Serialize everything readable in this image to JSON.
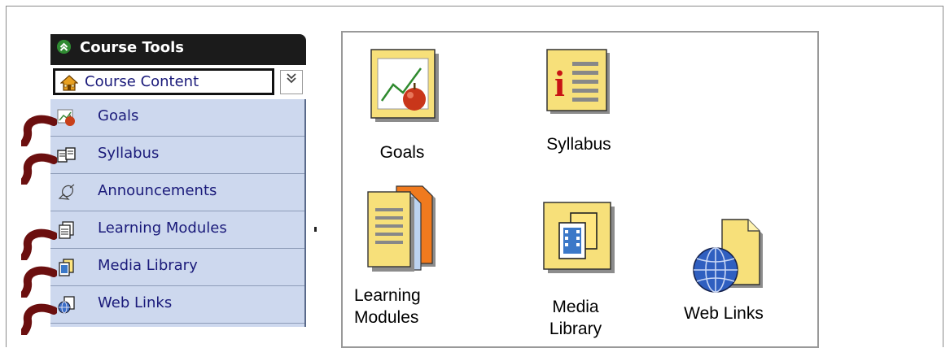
{
  "sidebar": {
    "header_title": "Course Tools",
    "collapse_glyph": "⇑",
    "course_content_label": "Course Content",
    "expand_glyph": "⌄",
    "items": [
      {
        "label": "Goals",
        "icon": "goals-icon"
      },
      {
        "label": "Syllabus",
        "icon": "syllabus-icon"
      },
      {
        "label": "Announcements",
        "icon": "announcements-icon"
      },
      {
        "label": "Learning Modules",
        "icon": "learning-modules-icon"
      },
      {
        "label": "Media Library",
        "icon": "media-library-icon"
      },
      {
        "label": "Web Links",
        "icon": "web-links-icon"
      }
    ]
  },
  "panel": {
    "tiles": [
      {
        "label": "Goals",
        "icon": "goals-icon"
      },
      {
        "label": "Syllabus",
        "icon": "syllabus-icon"
      },
      {
        "label_line1": "Learning",
        "label_line2": "Modules",
        "icon": "learning-modules-icon"
      },
      {
        "label_line1": "Media",
        "label_line2": "Library",
        "icon": "media-library-icon"
      },
      {
        "label": "Web Links",
        "icon": "web-links-icon"
      }
    ]
  },
  "colors": {
    "header_bg": "#1b1b1b",
    "list_bg": "#cdd8ee",
    "link_text": "#1a1a7a",
    "hook": "#6b0f0f"
  }
}
